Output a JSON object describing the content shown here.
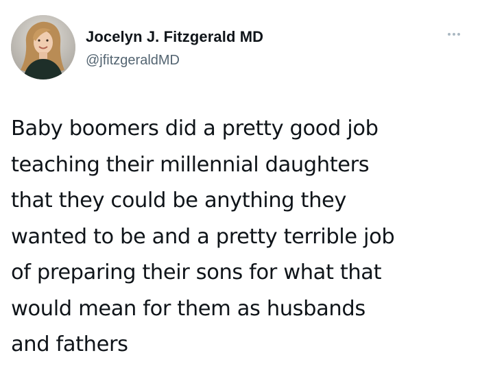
{
  "author": {
    "display_name": "Jocelyn J. Fitzgerald MD",
    "handle": "@jfitzgeraldMD",
    "avatar_icon": "profile-photo"
  },
  "menu": {
    "icon": "more-options-icon"
  },
  "tweet": {
    "lines": [
      "Baby boomers did a pretty good job",
      "teaching their millennial daughters",
      "that they could be anything they",
      "wanted to be and a pretty terrible job",
      "of preparing their sons for what that",
      "would mean for them as husbands",
      "and fathers"
    ]
  },
  "colors": {
    "text": "#0f1419",
    "secondary_text": "#536471",
    "menu_dots": "#aab8c2",
    "background": "#ffffff"
  }
}
